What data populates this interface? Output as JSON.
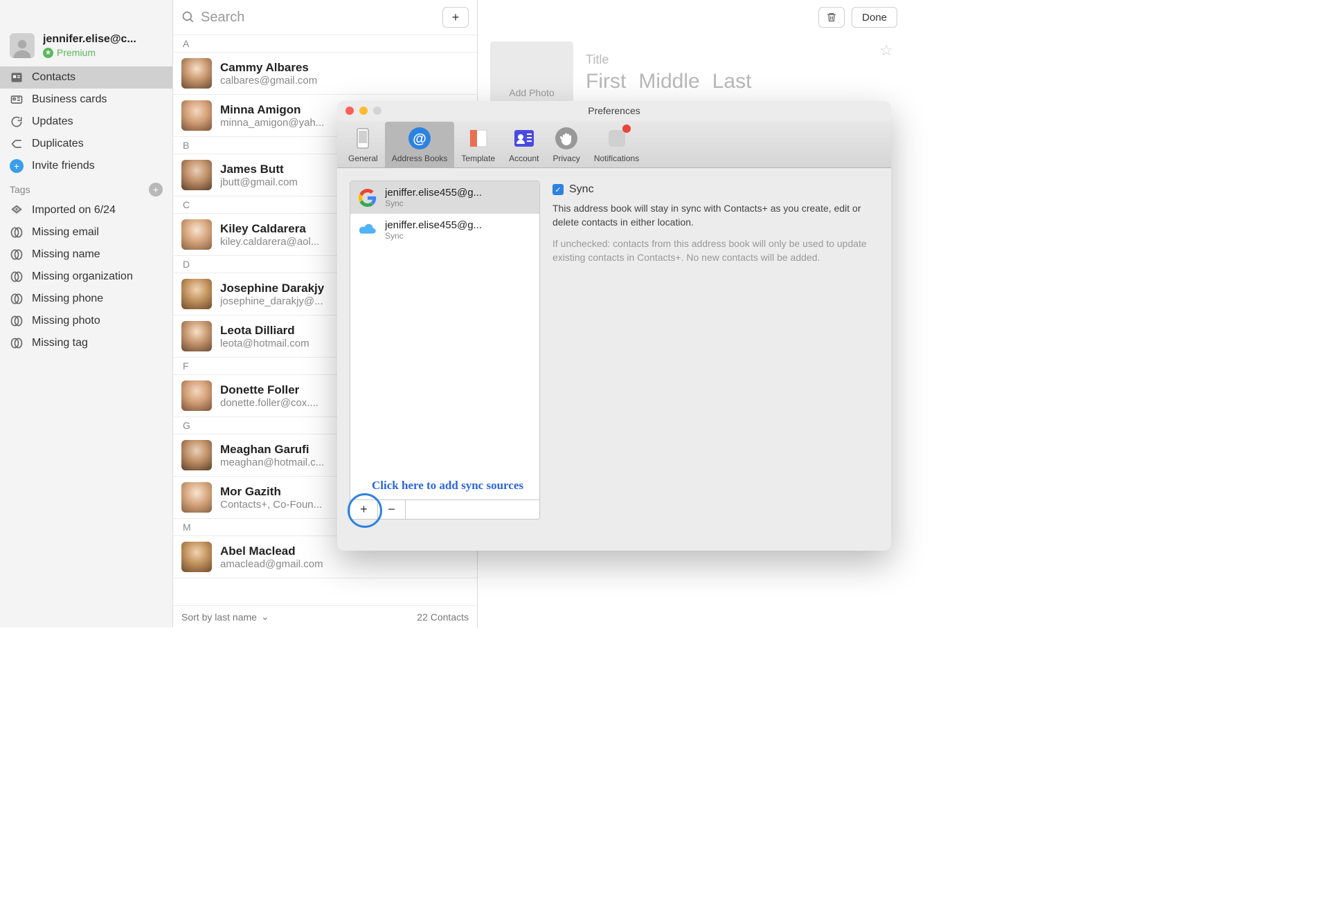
{
  "sidebar": {
    "user_email": "jennifer.elise@c...",
    "premium_label": "Premium",
    "nav": [
      {
        "label": "Contacts",
        "icon": "contacts-icon",
        "active": true
      },
      {
        "label": "Business cards",
        "icon": "business-card-icon"
      },
      {
        "label": "Updates",
        "icon": "updates-icon"
      },
      {
        "label": "Duplicates",
        "icon": "duplicates-icon"
      },
      {
        "label": "Invite friends",
        "icon": "invite-icon",
        "invite": true
      }
    ],
    "tags_header": "Tags",
    "tags": [
      {
        "label": "Imported on 6/24",
        "icon": "tag-icon"
      },
      {
        "label": "Missing email",
        "icon": "missing-icon"
      },
      {
        "label": "Missing name",
        "icon": "missing-icon"
      },
      {
        "label": "Missing organization",
        "icon": "missing-icon"
      },
      {
        "label": "Missing phone",
        "icon": "missing-icon"
      },
      {
        "label": "Missing photo",
        "icon": "missing-icon"
      },
      {
        "label": "Missing tag",
        "icon": "missing-icon"
      }
    ]
  },
  "contact_list": {
    "search_placeholder": "Search",
    "sections": [
      {
        "letter": "A",
        "contacts": [
          {
            "name": "Cammy Albares",
            "secondary": "calbares@gmail.com"
          },
          {
            "name": "Minna Amigon",
            "secondary": "minna_amigon@yah..."
          }
        ]
      },
      {
        "letter": "B",
        "contacts": [
          {
            "name": "James Butt",
            "secondary": "jbutt@gmail.com"
          }
        ]
      },
      {
        "letter": "C",
        "contacts": [
          {
            "name": "Kiley Caldarera",
            "secondary": "kiley.caldarera@aol..."
          }
        ]
      },
      {
        "letter": "D",
        "contacts": [
          {
            "name": "Josephine Darakjy",
            "secondary": "josephine_darakjy@..."
          },
          {
            "name": "Leota Dilliard",
            "secondary": "leota@hotmail.com"
          }
        ]
      },
      {
        "letter": "F",
        "contacts": [
          {
            "name": "Donette Foller",
            "secondary": "donette.foller@cox...."
          }
        ]
      },
      {
        "letter": "G",
        "contacts": [
          {
            "name": "Meaghan Garufi",
            "secondary": "meaghan@hotmail.c..."
          },
          {
            "name": "Mor Gazith",
            "secondary": "Contacts+, Co-Foun..."
          }
        ]
      },
      {
        "letter": "M",
        "contacts": [
          {
            "name": "Abel Maclead",
            "secondary": "amaclead@gmail.com"
          }
        ]
      }
    ],
    "sort_label": "Sort by last name",
    "count_label": "22 Contacts"
  },
  "detail": {
    "done_label": "Done",
    "add_photo_label": "Add Photo",
    "title_placeholder": "Title",
    "first_placeholder": "First",
    "middle_placeholder": "Middle",
    "last_placeholder": "Last"
  },
  "preferences": {
    "window_title": "Preferences",
    "tabs": [
      {
        "label": "General",
        "icon": "general-icon"
      },
      {
        "label": "Address Books",
        "icon": "at-icon",
        "active": true
      },
      {
        "label": "Template",
        "icon": "template-icon"
      },
      {
        "label": "Account",
        "icon": "account-icon"
      },
      {
        "label": "Privacy",
        "icon": "privacy-icon"
      },
      {
        "label": "Notifications",
        "icon": "notifications-icon",
        "dot": true
      }
    ],
    "books": [
      {
        "title": "jeniffer.elise455@g...",
        "sub": "Sync",
        "provider": "google",
        "selected": true
      },
      {
        "title": "jeniffer.elise455@g...",
        "sub": "Sync",
        "provider": "icloud"
      }
    ],
    "annotation": "Click here to add sync sources",
    "sync": {
      "checkbox_checked": true,
      "label": "Sync",
      "description": "This address book will stay in sync with Contacts+ as you create, edit or delete contacts in either location.",
      "note": "If unchecked: contacts from this address book will only be used to update existing contacts in Contacts+. No new contacts will be added."
    }
  }
}
